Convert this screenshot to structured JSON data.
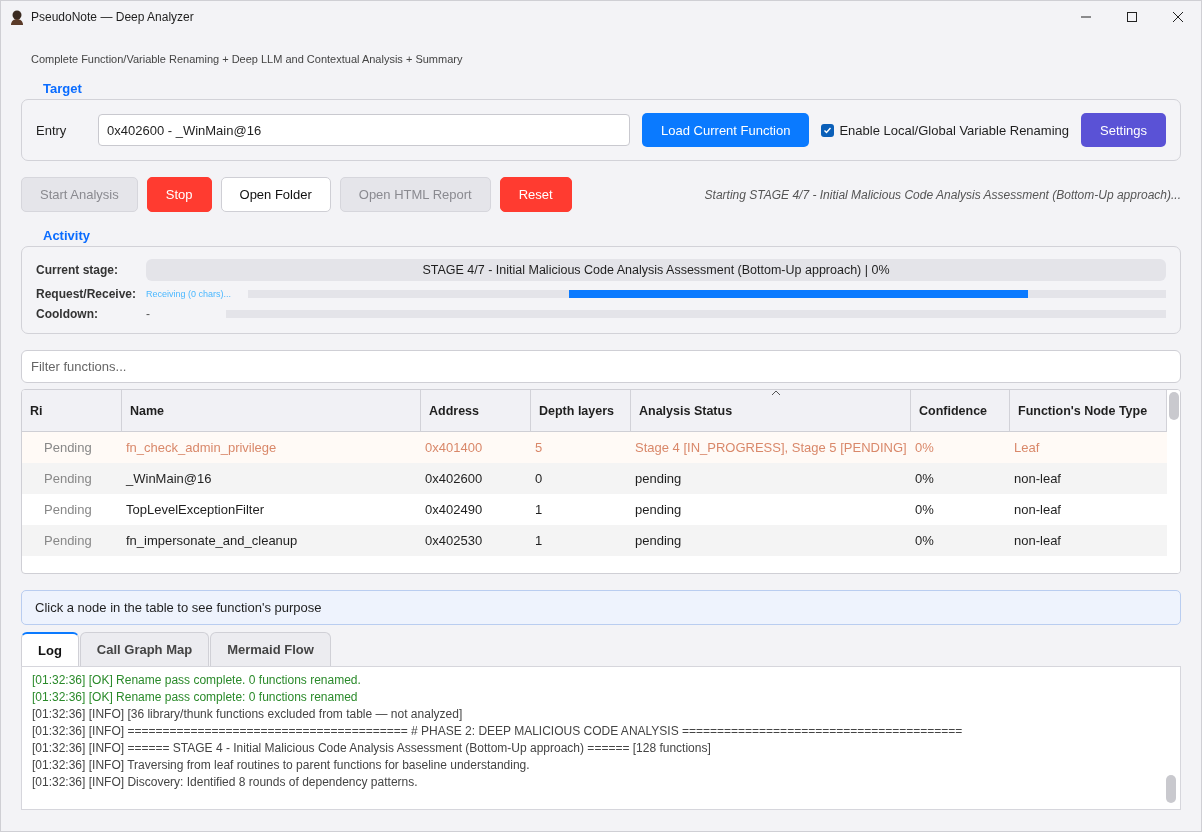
{
  "window": {
    "title": "PseudoNote — Deep Analyzer"
  },
  "subtitle": "Complete Function/Variable Renaming + Deep LLM and Contextual Analysis + Summary",
  "target": {
    "title": "Target",
    "entry_label": "Entry",
    "entry_value": "0x402600 - _WinMain@16",
    "load_button": "Load Current Function",
    "rename": {
      "label": "Enable Local/Global Variable Renaming",
      "checked": true
    },
    "settings_button": "Settings"
  },
  "actions": [
    {
      "label": "Start Analysis",
      "kind": "disabled"
    },
    {
      "label": "Stop",
      "kind": "danger"
    },
    {
      "label": "Open Folder",
      "kind": "default"
    },
    {
      "label": "Open HTML Report",
      "kind": "disabled"
    },
    {
      "label": "Reset",
      "kind": "danger"
    }
  ],
  "status_message": "Starting STAGE 4/7 - Initial Malicious Code Analysis Assessment (Bottom-Up approach)...",
  "activity": {
    "title": "Activity",
    "current_stage": {
      "label": "Current stage:",
      "text": "STAGE 4/7 - Initial Malicious Code Analysis Assessment (Bottom-Up approach) | 0%",
      "level": 0
    },
    "request": {
      "label": "Request/Receive:",
      "reading": "Receiving (0 chars)...",
      "busy": true
    },
    "cooldown": {
      "label": "Cooldown:",
      "reading": "-",
      "level": 0
    }
  },
  "filter": {
    "placeholder": "Filter functions..."
  },
  "table": {
    "columns": [
      {
        "label": "Ri",
        "sorted": false
      },
      {
        "label": "Name",
        "sorted": false
      },
      {
        "label": "Address",
        "sorted": false
      },
      {
        "label": "Depth layers",
        "sorted": false
      },
      {
        "label": "Analysis Status",
        "sorted": true
      },
      {
        "label": "Confidence",
        "sorted": false
      },
      {
        "label": "Function's Node Type",
        "sorted": false
      }
    ],
    "rows": [
      {
        "highlighted": true,
        "cells": [
          "Pending",
          "fn_check_admin_privilege",
          "0x401400",
          "5",
          "Stage 4 [IN_PROGRESS], Stage 5 [PENDING]",
          "0%",
          "Leaf"
        ]
      },
      {
        "highlighted": false,
        "cells": [
          "Pending",
          "_WinMain@16",
          "0x402600",
          "0",
          "pending",
          "0%",
          "non-leaf"
        ]
      },
      {
        "highlighted": false,
        "cells": [
          "Pending",
          "TopLevelExceptionFilter",
          "0x402490",
          "1",
          "pending",
          "0%",
          "non-leaf"
        ]
      },
      {
        "highlighted": false,
        "cells": [
          "Pending",
          "fn_impersonate_and_cleanup",
          "0x402530",
          "1",
          "pending",
          "0%",
          "non-leaf"
        ]
      }
    ]
  },
  "info_bar": "Click a node in the table to see function's purpose",
  "tabs": [
    {
      "label": "Log",
      "selected": true
    },
    {
      "label": "Call Graph Map",
      "selected": false
    },
    {
      "label": "Mermaid Flow",
      "selected": false
    }
  ],
  "log": [
    {
      "kind": "ok",
      "text": "[01:32:36] [OK] Rename pass complete. 0 functions renamed."
    },
    {
      "kind": "ok",
      "text": "[01:32:36] [OK] Rename pass complete: 0 functions renamed"
    },
    {
      "kind": "info",
      "text": "[01:32:36] [INFO] [36 library/thunk functions excluded from table — not analyzed]"
    },
    {
      "kind": "info",
      "text": "[01:32:36] [INFO] ======================================== # PHASE 2: DEEP MALICIOUS CODE ANALYSIS ========================================"
    },
    {
      "kind": "info",
      "text": "[01:32:36] [INFO] ====== STAGE 4 - Initial Malicious Code Analysis Assessment (Bottom-Up approach) ====== [128 functions]"
    },
    {
      "kind": "info",
      "text": "[01:32:36] [INFO] Traversing from leaf routines to parent functions for baseline understanding."
    },
    {
      "kind": "info",
      "text": "[01:32:36] [INFO] Discovery: Identified 8 rounds of dependency patterns."
    }
  ]
}
